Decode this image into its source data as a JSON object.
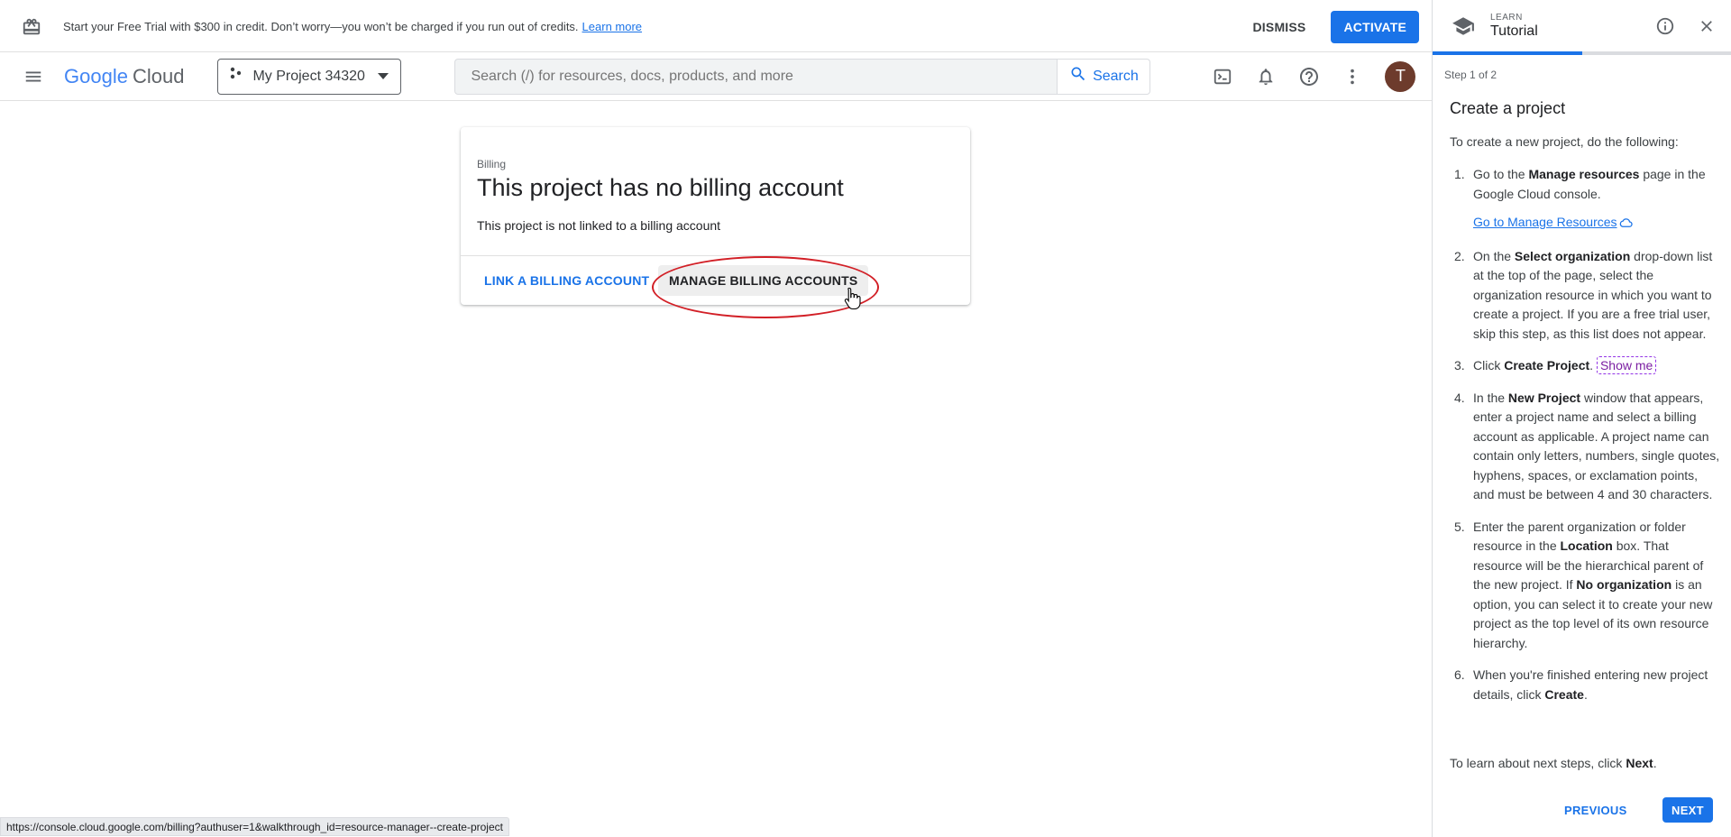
{
  "banner": {
    "text": "Start your Free Trial with $300 in credit. Don’t worry—you won’t be charged if you run out of credits.",
    "link": "Learn more",
    "dismiss": "DISMISS",
    "activate": "ACTIVATE",
    "icon": "gift-icon"
  },
  "nav": {
    "logo_google": "Google",
    "logo_cloud": "Cloud",
    "project_name": "My Project 34320",
    "search_placeholder": "Search (/) for resources, docs, products, and more",
    "search_button": "Search",
    "avatar_letter": "T",
    "icons": [
      "hamburger-menu-icon",
      "cloud-shell-icon",
      "notifications-bell-icon",
      "help-icon",
      "more-vert-icon"
    ]
  },
  "billing": {
    "eyebrow": "Billing",
    "title": "This project has no billing account",
    "description": "This project is not linked to a billing account",
    "link_button": "LINK A BILLING ACCOUNT",
    "manage_button": "MANAGE BILLING ACCOUNTS"
  },
  "status_url": "https://console.cloud.google.com/billing?authuser=1&walkthrough_id=resource-manager--create-project",
  "tutorial": {
    "eyebrow": "LEARN",
    "title": "Tutorial",
    "progress": 0.5,
    "step": "Step 1 of 2",
    "heading": "Create a project",
    "intro": "To create a new project, do the following:",
    "steps": [
      {
        "num": "1.",
        "a": "Go to the ",
        "b": "Manage resources",
        "c": " page in the Google Cloud console.",
        "link": "Go to Manage Resources"
      },
      {
        "num": "2.",
        "a": "On the ",
        "b": "Select organization",
        "c": " drop-down list at the top of the page, select the organization resource in which you want to create a project. If you are a free trial user, skip this step, as this list does not appear."
      },
      {
        "num": "3.",
        "a": "Click ",
        "b": "Create Project",
        "c": ".",
        "show_me": "Show me"
      },
      {
        "num": "4.",
        "a": "In the ",
        "b": "New Project",
        "c": " window that appears, enter a project name and select a billing account as applicable. A project name can contain only letters, numbers, single quotes, hyphens, spaces, or exclamation points, and must be between 4 and 30 characters."
      },
      {
        "num": "5.",
        "a": "Enter the parent organization or folder resource in the ",
        "b": "Location",
        "c": " box. That resource will be the hierarchical parent of the new project. If ",
        "d": "No organization",
        "e": " is an option, you can select it to create your new project as the top level of its own resource hierarchy."
      },
      {
        "num": "6.",
        "a": "When you're finished entering new project details, click ",
        "b": "Create",
        "c": "."
      }
    ],
    "outro_a": "To learn about next steps, click ",
    "outro_b": "Next",
    "outro_c": ".",
    "previous": "PREVIOUS",
    "next": "NEXT"
  },
  "colors": {
    "accent": "#1a73e8",
    "highlight_ring": "#d21f26",
    "avatar": "#6d3b2c"
  }
}
